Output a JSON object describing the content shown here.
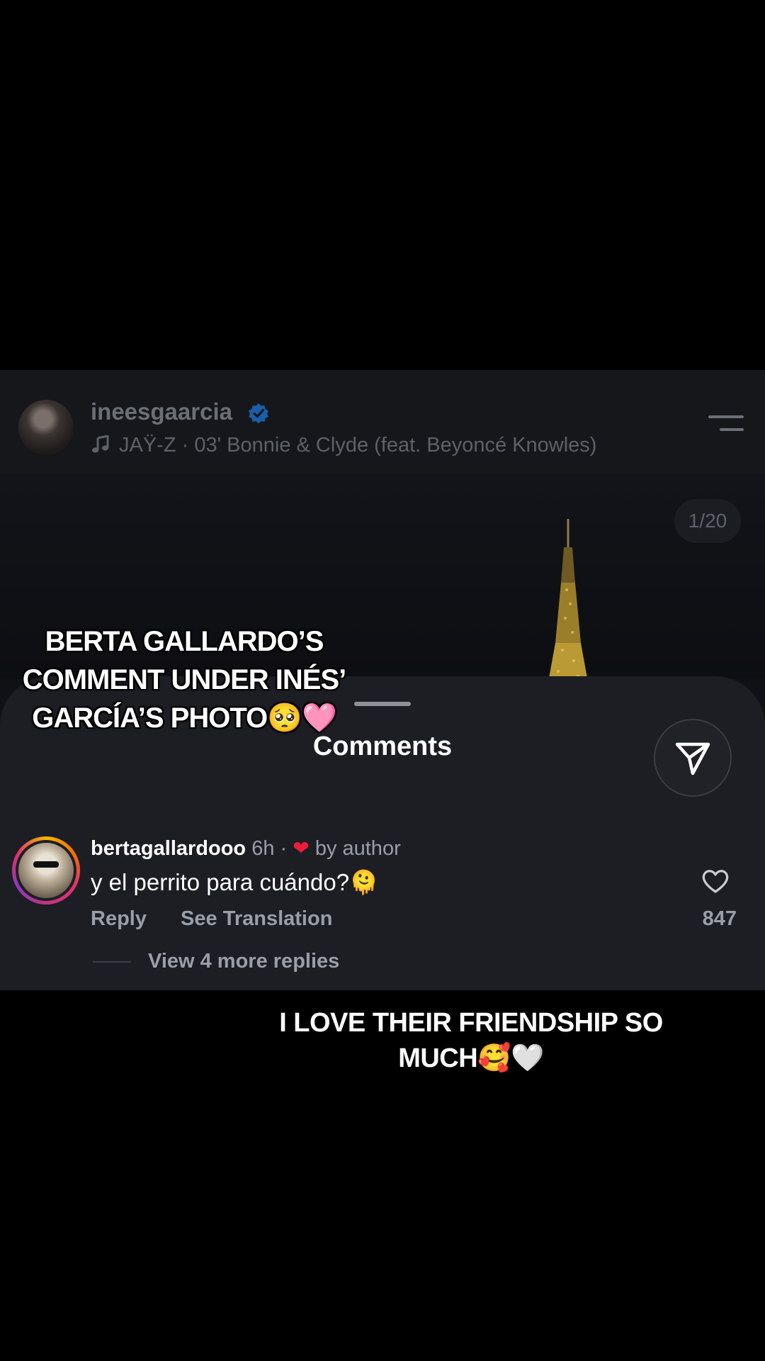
{
  "post": {
    "username": "ineesgaarcia",
    "music": "JAŸ-Z · 03' Bonnie & Clyde (feat. Beyoncé Knowles)",
    "counter": "1/20"
  },
  "comments_sheet": {
    "title": "Comments",
    "comment": {
      "username": "bertagallardooo",
      "time": "6h",
      "separator": "·",
      "liked_by": "by author",
      "text": "y el perrito para cuándo?🫠",
      "reply_label": "Reply",
      "translate_label": "See Translation",
      "like_count": "847",
      "more_replies": "View 4 more replies"
    }
  },
  "overlay": {
    "caption_top_line1": "BERTA GALLARDO’S",
    "caption_top_line2": "COMMENT UNDER INÉS’",
    "caption_top_line3": "GARCÍA’S PHOTO🥺🩷",
    "caption_bottom_line1": "I LOVE THEIR FRIENDSHIP SO",
    "caption_bottom_line2": "MUCH🥰🤍"
  },
  "colors": {
    "verified": "#1e88ff",
    "author_heart": "#ed1c3a",
    "sheet_bg": "#1c1e23"
  }
}
